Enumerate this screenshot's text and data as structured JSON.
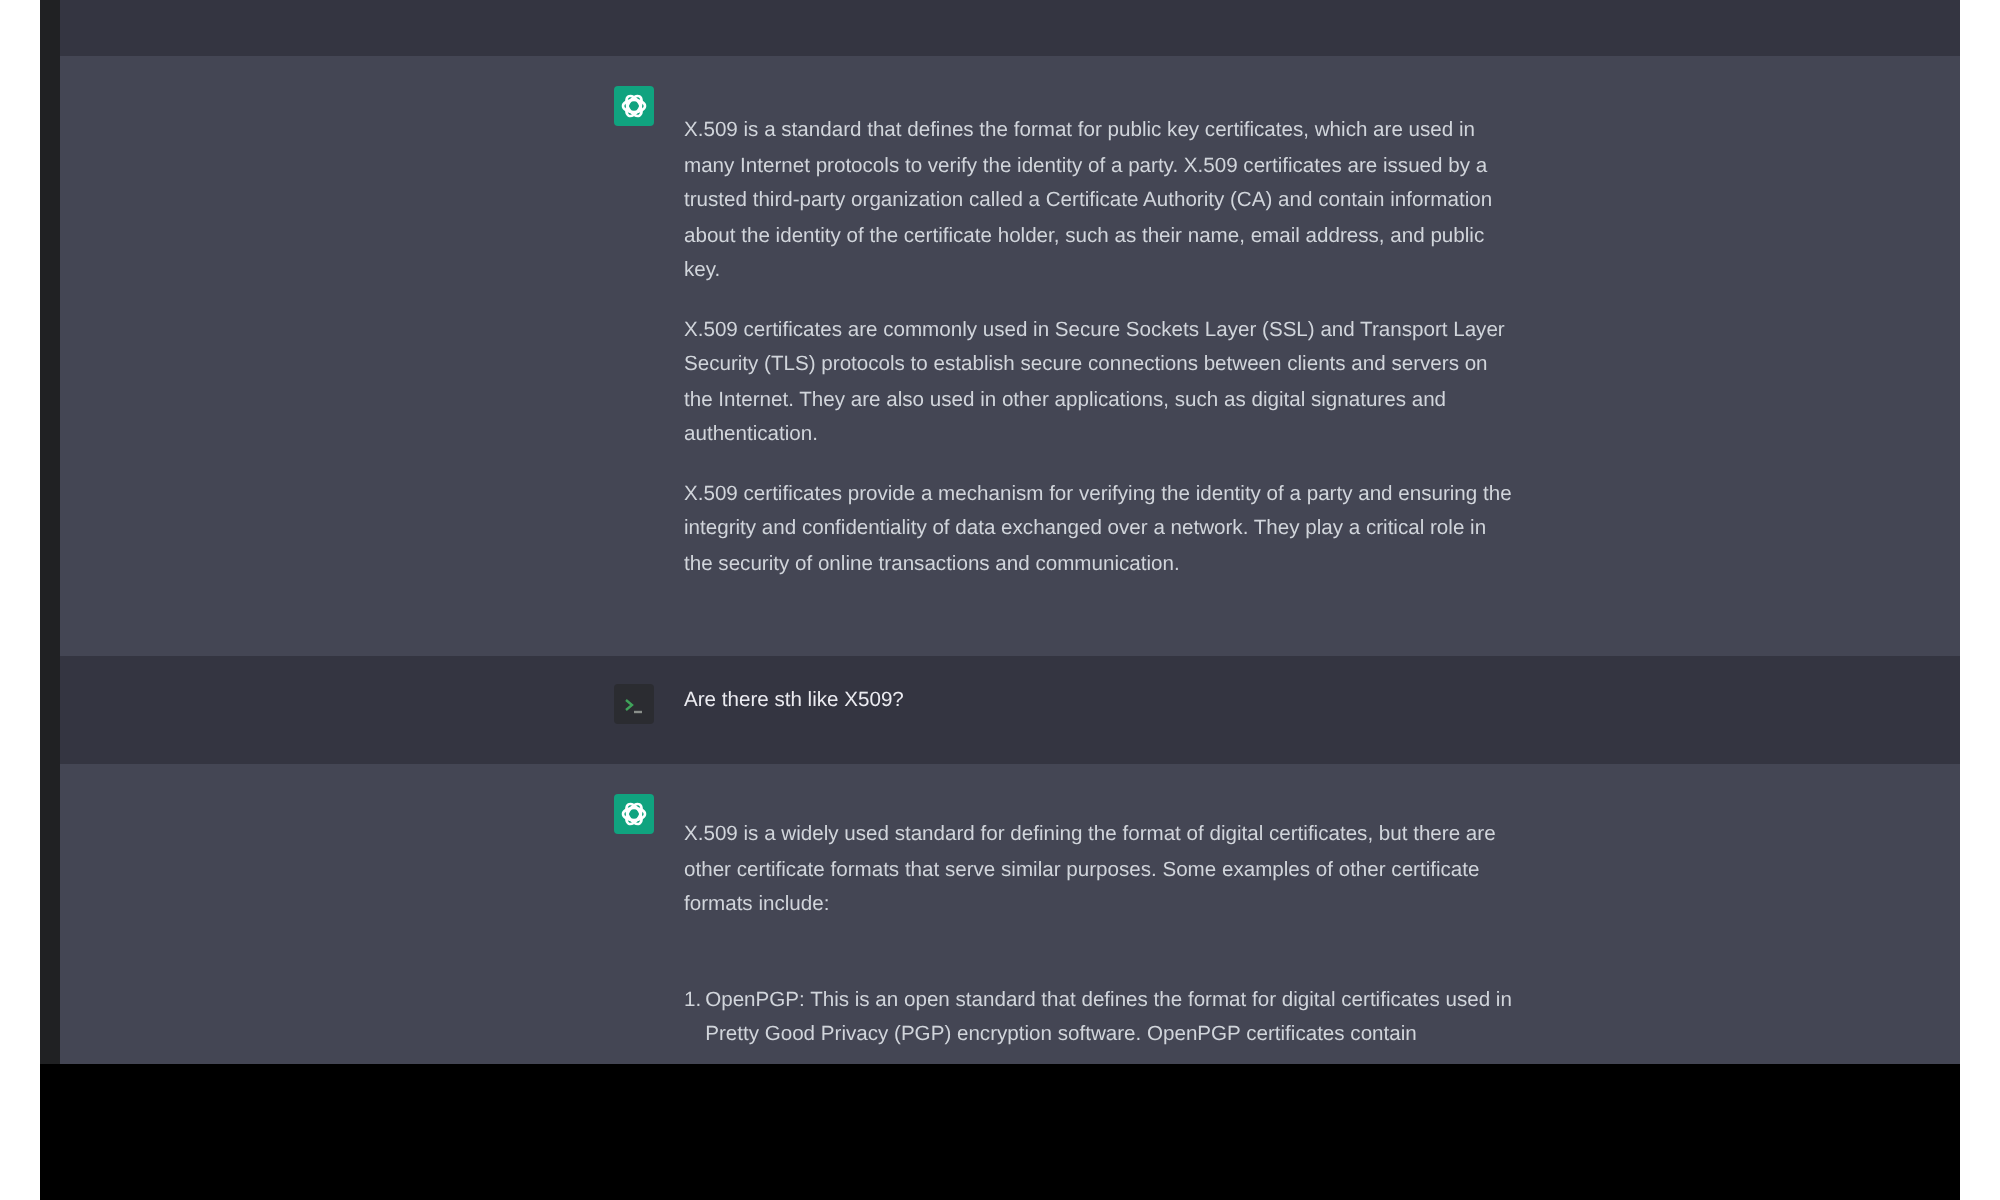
{
  "messages": [
    {
      "kind": "user"
    },
    {
      "kind": "assistant",
      "paragraphs": [
        "X.509 is a standard that defines the format for public key certificates, which are used in many Internet protocols to verify the identity of a party. X.509 certificates are issued by a trusted third-party organization called a Certificate Authority (CA) and contain information about the identity of the certificate holder, such as their name, email address, and public key.",
        "X.509 certificates are commonly used in Secure Sockets Layer (SSL) and Transport Layer Security (TLS) protocols to establish secure connections between clients and servers on the Internet. They are also used in other applications, such as digital signatures and authentication.",
        "X.509 certificates provide a mechanism for verifying the identity of a party and ensuring the integrity and confidentiality of data exchanged over a network. They play a critical role in the security of online transactions and communication."
      ]
    },
    {
      "kind": "user",
      "paragraphs": [
        "Are there sth like X509?"
      ]
    },
    {
      "kind": "assistant",
      "paragraphs": [
        "X.509 is a widely used standard for defining the format of digital certificates, but there are other certificate formats that serve similar purposes. Some examples of other certificate formats include:"
      ],
      "list": [
        {
          "number": "1.",
          "text": "OpenPGP: This is an open standard that defines the format for digital certificates used in Pretty Good Privacy (PGP) encryption software. OpenPGP certificates contain"
        }
      ]
    }
  ]
}
